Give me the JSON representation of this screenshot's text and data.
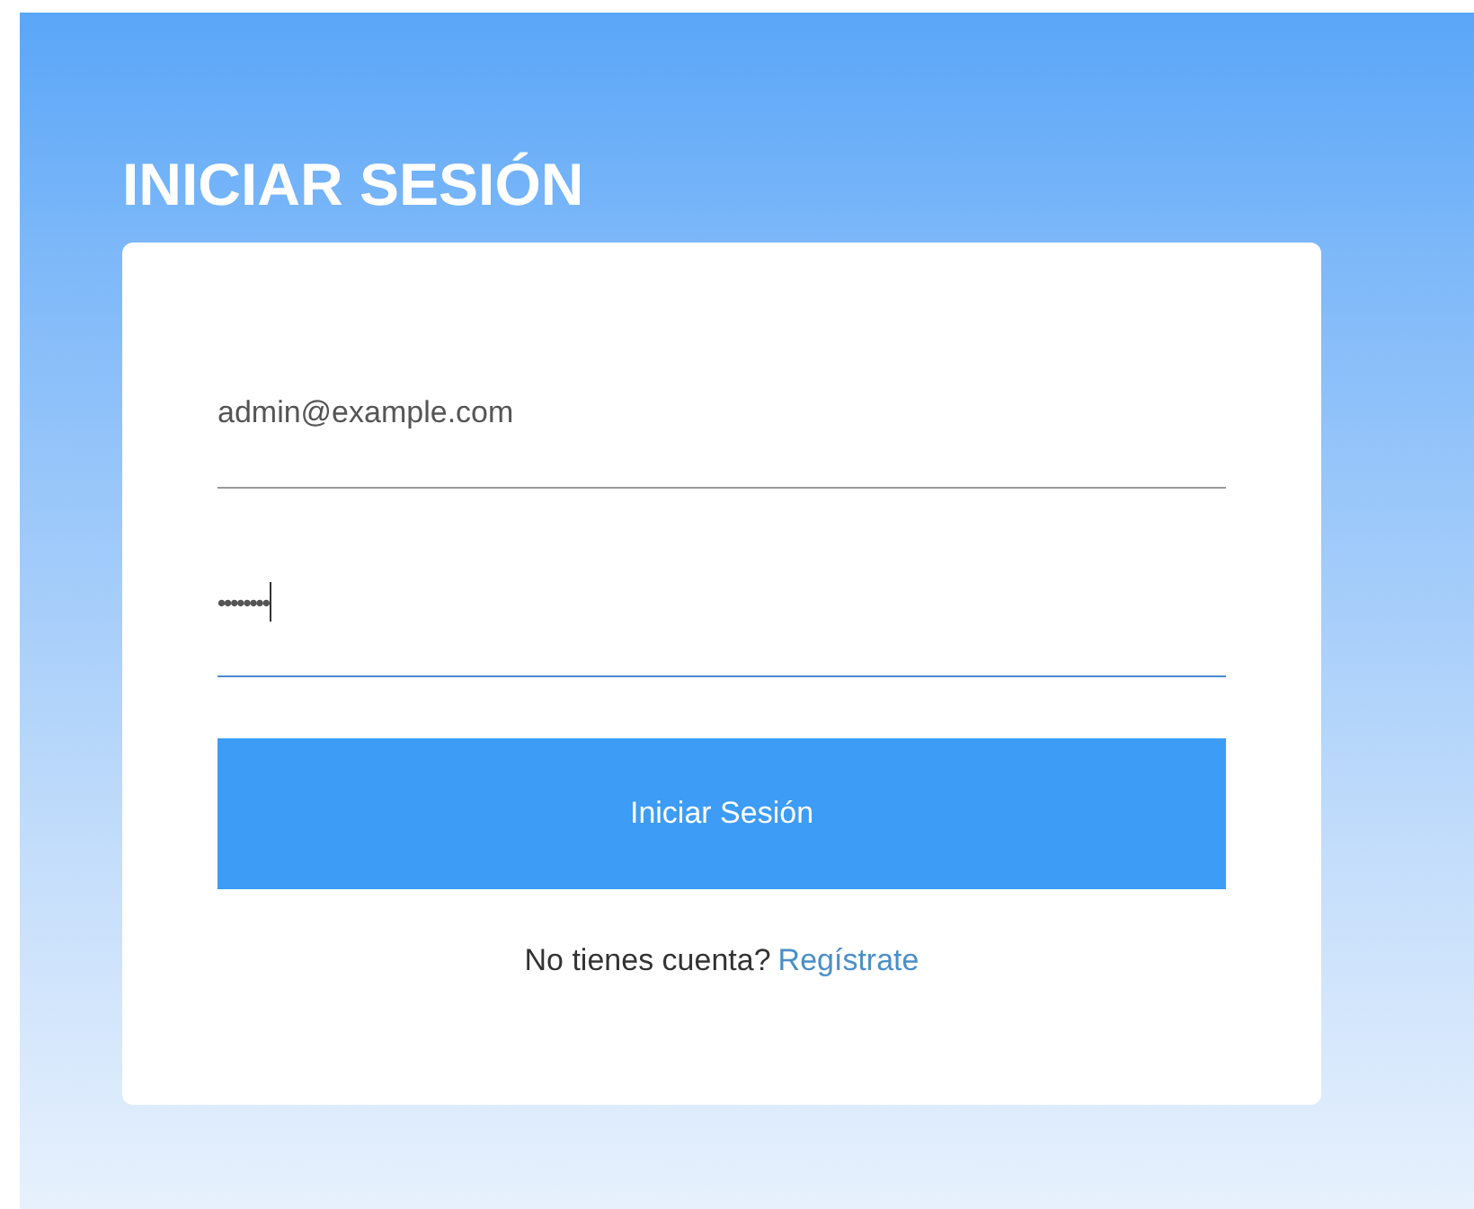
{
  "title": "INICIAR SESIÓN",
  "fields": [
    {
      "kind": "email",
      "value": "admin@example.com",
      "focused": false
    },
    {
      "kind": "password",
      "value": "••••••••",
      "focused": true
    }
  ],
  "submit_button": "Iniciar Sesión",
  "signup": {
    "prompt": "No tienes cuenta?",
    "link": "Regístrate"
  }
}
